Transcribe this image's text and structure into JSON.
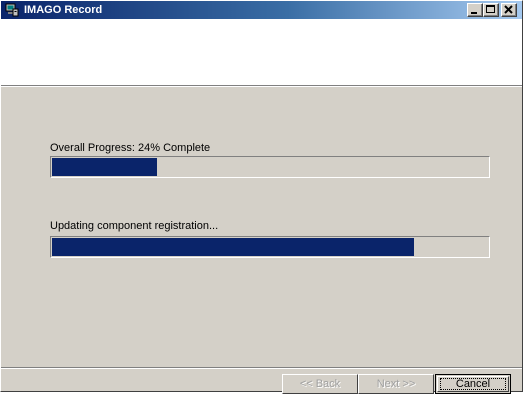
{
  "window": {
    "title": "IMAGO Record",
    "controls": {
      "minimize_icon": "minimize-icon",
      "maximize_icon": "maximize-icon",
      "close_icon": "close-icon"
    },
    "app_icon": "computer-icon"
  },
  "progress": {
    "overall_label": "Overall Progress: 24% Complete",
    "overall_fraction": 0.24,
    "task_label": "Updating component registration...",
    "task_fraction": 0.83
  },
  "buttons": {
    "back_label": "<< Back",
    "next_label": "Next >>",
    "cancel_label": "Cancel"
  },
  "colors": {
    "titlebar_start": "#0a246a",
    "titlebar_end": "#a6caf0",
    "progress_fill": "#0a246a",
    "dialog_face": "#d4d0c8"
  }
}
